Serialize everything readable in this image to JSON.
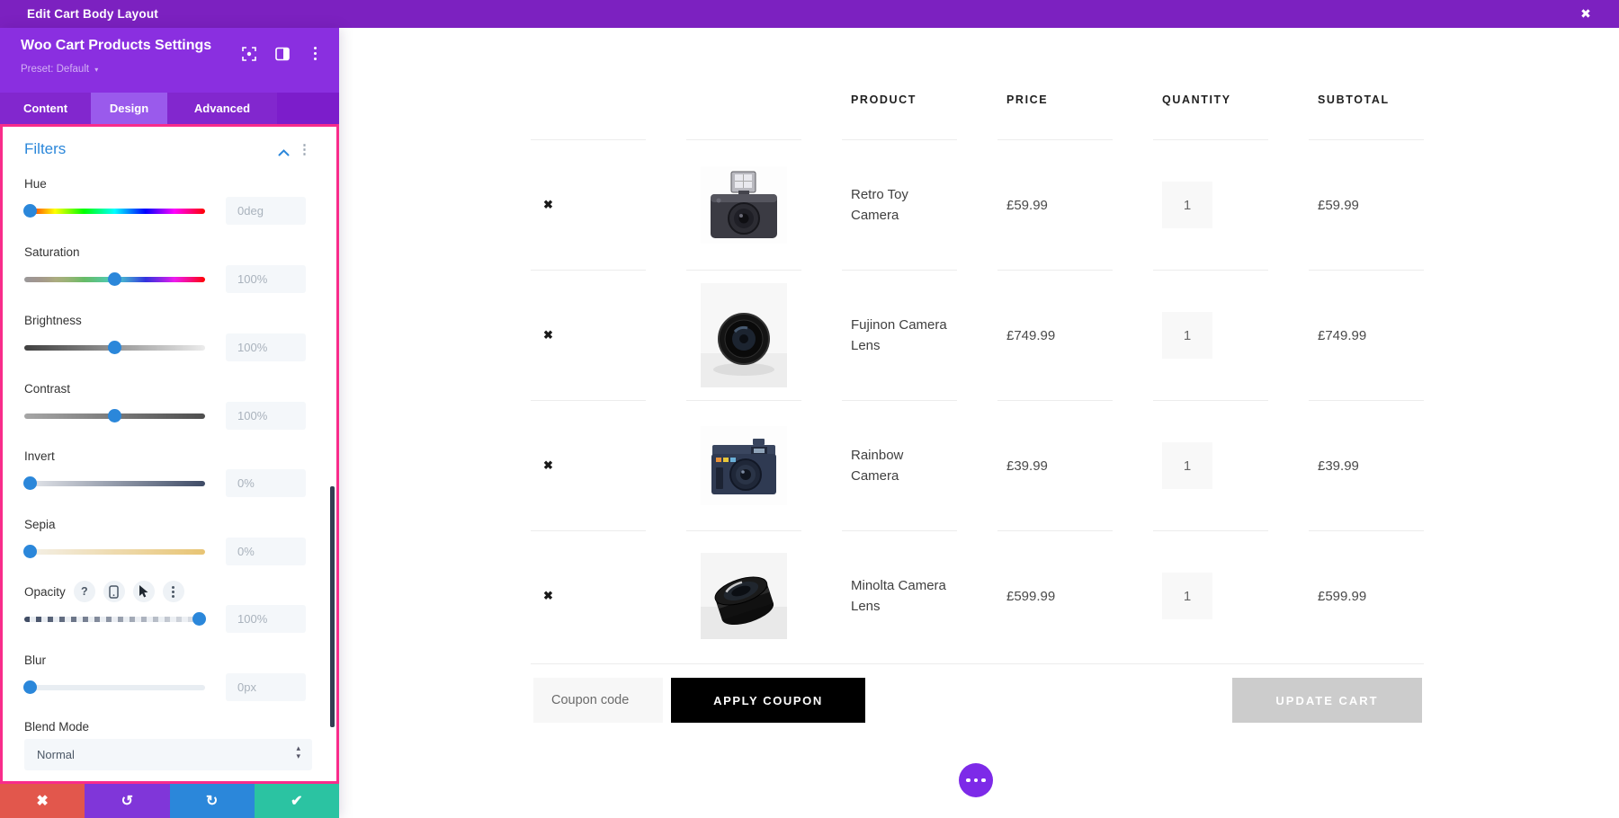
{
  "topbar": {
    "title": "Edit Cart Body Layout"
  },
  "icons": {
    "close": "✖",
    "remove": "✖",
    "kebab": "⋮",
    "help": "?",
    "undo": "↺",
    "redo": "↻",
    "save": "✔",
    "discard": "✖",
    "preset_caret": "▾",
    "select_up": "▴",
    "select_down": "▾"
  },
  "panel": {
    "title": "Woo Cart Products Settings",
    "preset_label": "Preset: Default",
    "tabs": [
      {
        "label": "Content"
      },
      {
        "label": "Design"
      },
      {
        "label": "Advanced"
      }
    ],
    "active_tab": "Design",
    "filters_section": {
      "title": "Filters",
      "items": [
        {
          "label": "Hue",
          "value": "0deg"
        },
        {
          "label": "Saturation",
          "value": "100%"
        },
        {
          "label": "Brightness",
          "value": "100%"
        },
        {
          "label": "Contrast",
          "value": "100%"
        },
        {
          "label": "Invert",
          "value": "0%"
        },
        {
          "label": "Sepia",
          "value": "0%"
        },
        {
          "label": "Opacity",
          "value": "100%"
        },
        {
          "label": "Blur",
          "value": "0px"
        }
      ],
      "blend_mode": {
        "label": "Blend Mode",
        "value": "Normal"
      }
    }
  },
  "cart": {
    "columns": [
      "PRODUCT",
      "PRICE",
      "QUANTITY",
      "SUBTOTAL"
    ],
    "rows": [
      {
        "name": "Retro Toy\nCamera",
        "price": "£59.99",
        "quantity": "1",
        "subtotal": "£59.99"
      },
      {
        "name": "Fujinon Camera\nLens",
        "price": "£749.99",
        "quantity": "1",
        "subtotal": "£749.99"
      },
      {
        "name": "Rainbow\nCamera",
        "price": "£39.99",
        "quantity": "1",
        "subtotal": "£39.99"
      },
      {
        "name": "Minolta Camera\nLens",
        "price": "£599.99",
        "quantity": "1",
        "subtotal": "£599.99"
      }
    ],
    "coupon_placeholder": "Coupon code",
    "apply_coupon_label": "APPLY COUPON",
    "update_cart_label": "UPDATE CART"
  },
  "colors": {
    "builder_purple": "#7c21c0",
    "header_purple": "#8a2fe0",
    "tabbar_purple": "#7c1dcb",
    "active_tab_purple": "#9a5aec",
    "highlight_pink": "#f92c8b",
    "accent_blue": "#2b87da",
    "save_green": "#2bc3a2",
    "discard_red": "#e2574c",
    "undo_purple": "#8036d9",
    "redo_blue": "#2b87da",
    "fab_purple": "#7d2ae8",
    "apply_black": "#000000",
    "update_gray": "#cccccc"
  }
}
